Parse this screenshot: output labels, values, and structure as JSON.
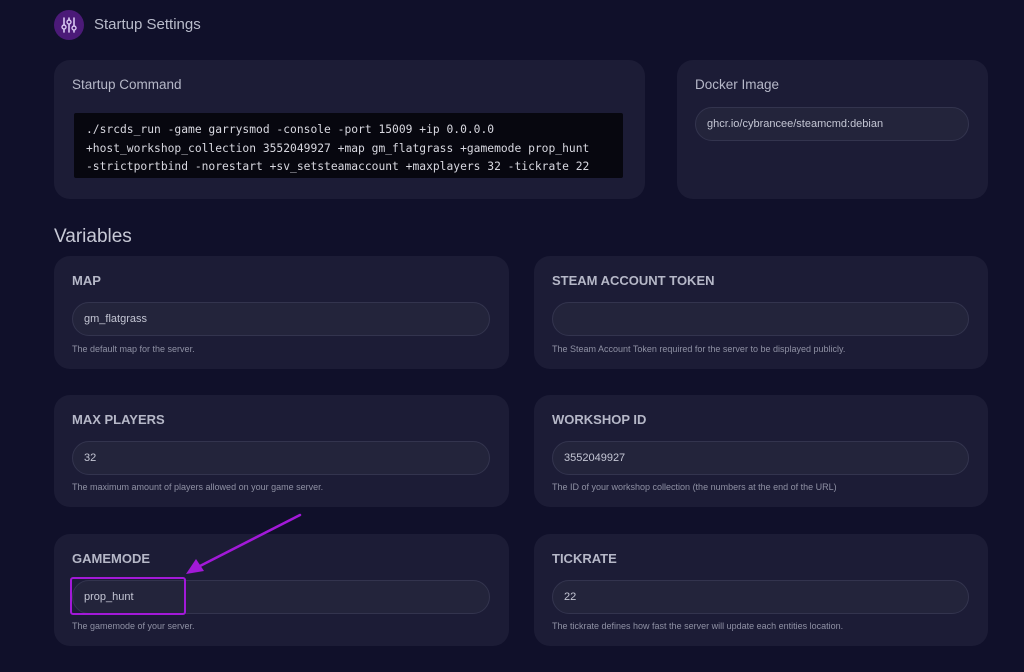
{
  "header": {
    "title": "Startup Settings",
    "icon": "sliders-icon"
  },
  "startup": {
    "title": "Startup Command",
    "command_lines": [
      "./srcds_run -game garrysmod -console -port 15009 +ip 0.0.0.0",
      "+host_workshop_collection 3552049927 +map gm_flatgrass +gamemode prop_hunt",
      "-strictportbind -norestart +sv_setsteamaccount +maxplayers 32 -tickrate 22"
    ]
  },
  "docker": {
    "title": "Docker Image",
    "value": "ghcr.io/cybrancee/steamcmd:debian"
  },
  "variables": {
    "title": "Variables",
    "map": {
      "label": "MAP",
      "value": "gm_flatgrass",
      "description": "The default map for the server."
    },
    "steam_token": {
      "label": "STEAM ACCOUNT TOKEN",
      "value": "",
      "description": "The Steam Account Token required for the server to be displayed publicly."
    },
    "max_players": {
      "label": "MAX PLAYERS",
      "value": "32",
      "description": "The maximum amount of players allowed on your game server."
    },
    "workshop_id": {
      "label": "WORKSHOP ID",
      "value": "3552049927",
      "description": "The ID of your workshop collection (the numbers at the end of the URL)"
    },
    "gamemode": {
      "label": "GAMEMODE",
      "value": "prop_hunt",
      "description": "The gamemode of your server."
    },
    "tickrate": {
      "label": "TICKRATE",
      "value": "22",
      "description": "The tickrate defines how fast the server will update each entities location."
    }
  },
  "colors": {
    "background": "#10102a",
    "card": "#1c1c36",
    "annotation": "#a219d8"
  }
}
